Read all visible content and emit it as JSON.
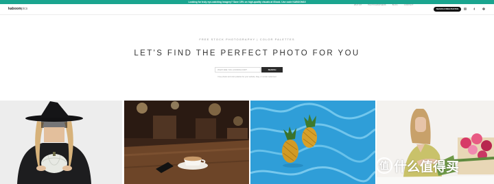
{
  "promo": {
    "text": "Looking for truly eye-catching imagery? Save 15% on high-quality visuals at iStock. Use code KABOOM15"
  },
  "header": {
    "logo_bold": "kaboom",
    "logo_light": "pics",
    "nav": [
      "WHY KP",
      "PHOTOGRAPHERS",
      "BLOG",
      "CONTACT"
    ],
    "search_button": "SEARCH FREE PHOTOS",
    "social_icons": [
      "instagram-icon",
      "facebook-icon",
      "pinterest-icon"
    ]
  },
  "hero": {
    "tagline": "FREE STOCK PHOTOGRAPHY | COLOR PALETTES",
    "headline": "LET'S FIND THE PERFECT PHOTO FOR YOU",
    "search_placeholder": "WHAT ARE YOU LOOKING FOR?",
    "search_button": "SEARCH",
    "hint": "Free photos and color palettes for your website, blog, or social media feed"
  },
  "photos": [
    {
      "subject": "woman in witch hat holding a white pumpkin"
    },
    {
      "subject": "coffee cup and phone on a cafe table"
    },
    {
      "subject": "pineapples floating in a blue pool"
    },
    {
      "subject": "woman arranging flowers"
    }
  ],
  "watermark": {
    "badge": "值",
    "text": "什么值得买"
  },
  "colors": {
    "accent": "#1aa58f",
    "dark": "#111111",
    "pool": "#2f9ed8"
  }
}
